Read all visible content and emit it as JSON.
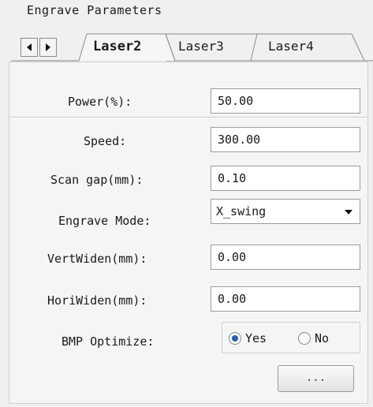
{
  "group": {
    "title": "Engrave Parameters"
  },
  "tabs": [
    {
      "label": "Laser2",
      "active": true
    },
    {
      "label": "Laser3",
      "active": false
    },
    {
      "label": "Laser4",
      "active": false
    }
  ],
  "fields": {
    "power": {
      "label": "Power(%):",
      "value": "50.00"
    },
    "speed": {
      "label": "Speed:",
      "value": "300.00"
    },
    "scan_gap": {
      "label": "Scan gap(mm):",
      "value": "0.10"
    },
    "mode": {
      "label": "Engrave Mode:",
      "value": "X_swing"
    },
    "vert": {
      "label": "VertWiden(mm):",
      "value": "0.00"
    },
    "hori": {
      "label": "HoriWiden(mm):",
      "value": "0.00"
    },
    "bmp": {
      "label": "BMP Optimize:",
      "yes": "Yes",
      "no": "No",
      "selected": "Yes"
    }
  },
  "buttons": {
    "browse": "..."
  },
  "colors": {
    "background": "#f0f0f0",
    "radio_selected": "#2b5fa8",
    "border": "#9c9c9c"
  }
}
